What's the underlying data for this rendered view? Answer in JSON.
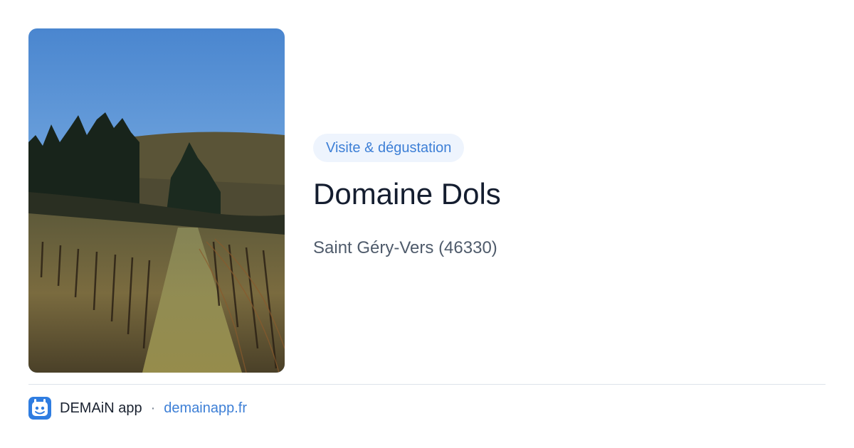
{
  "card": {
    "image": {
      "description_icon": "vineyard-photo",
      "alt": "Domaine Dols"
    },
    "tag_label": "Visite & dégustation",
    "title": "Domaine Dols",
    "location": "Saint Géry-Vers (46330)"
  },
  "footer": {
    "app_icon": "demain-app-icon",
    "app_name": "DEMAiN app",
    "separator": "·",
    "domain": "demainapp.fr"
  },
  "colors": {
    "accent": "#3d7fd6",
    "tag_background": "#eef4fd",
    "title": "#141d2f",
    "subtitle": "#4f5b6b"
  }
}
